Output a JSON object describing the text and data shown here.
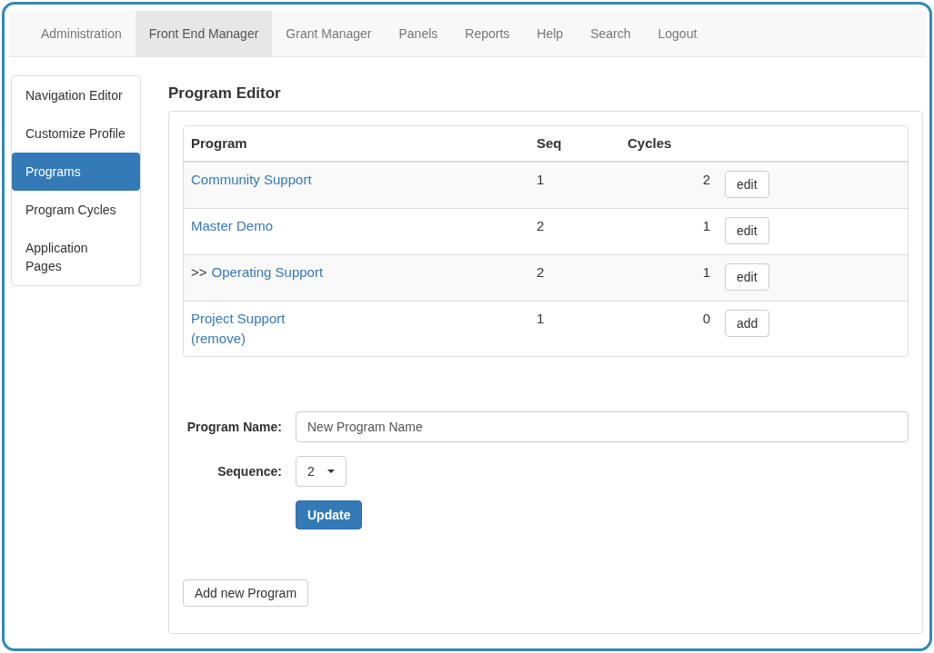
{
  "navbar": {
    "items": [
      {
        "label": "Administration",
        "selected": false
      },
      {
        "label": "Front End Manager",
        "selected": true
      },
      {
        "label": "Grant Manager",
        "selected": false
      },
      {
        "label": "Panels",
        "selected": false
      },
      {
        "label": "Reports",
        "selected": false
      },
      {
        "label": "Help",
        "selected": false
      },
      {
        "label": "Search",
        "selected": false
      },
      {
        "label": "Logout",
        "selected": false
      }
    ]
  },
  "sidebar": {
    "items": [
      {
        "label": "Navigation Editor",
        "selected": false
      },
      {
        "label": "Customize Profile",
        "selected": false
      },
      {
        "label": "Programs",
        "selected": true
      },
      {
        "label": "Program Cycles",
        "selected": false
      },
      {
        "label": "Application Pages",
        "selected": false
      }
    ]
  },
  "page_title": "Program Editor",
  "table": {
    "columns": [
      "Program",
      "Seq",
      "Cycles"
    ],
    "rows": [
      {
        "prefix": "",
        "program": "Community Support",
        "remove": "",
        "seq": "1",
        "cycles": "2",
        "action": "edit"
      },
      {
        "prefix": "",
        "program": "Master Demo",
        "remove": "",
        "seq": "2",
        "cycles": "1",
        "action": "edit"
      },
      {
        "prefix": ">>",
        "program": "Operating Support",
        "remove": "",
        "seq": "2",
        "cycles": "1",
        "action": "edit"
      },
      {
        "prefix": "",
        "program": "Project Support",
        "remove": "(remove)",
        "seq": "1",
        "cycles": "0",
        "action": "add"
      }
    ]
  },
  "form": {
    "name_label": "Program Name:",
    "name_value": "New Program Name",
    "sequence_label": "Sequence:",
    "sequence_value": "2",
    "update_button": "Update"
  },
  "add_button": "Add new Program"
}
